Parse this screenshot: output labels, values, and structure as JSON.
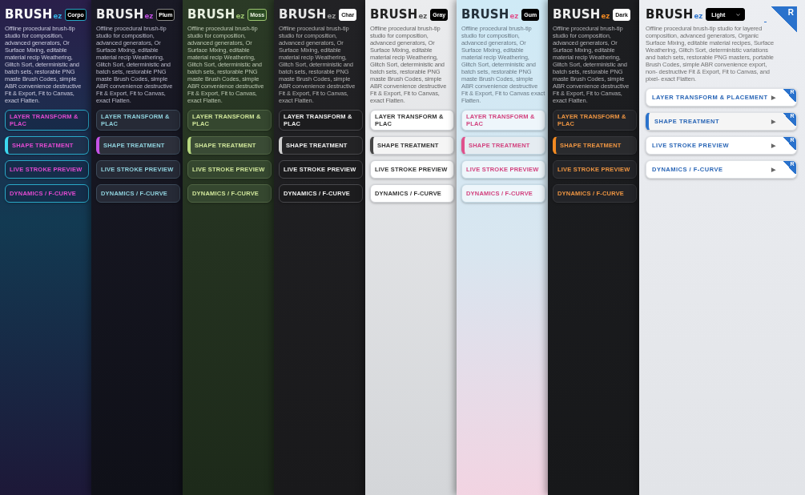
{
  "panels": [
    {
      "kind": "corpo",
      "logo": {
        "main": "BRUSH",
        "accent": "ez"
      },
      "theme_select": {
        "value": "Corpo",
        "dropdown": false
      },
      "description_lines": [
        "Offline procedural brush-tip studio for",
        "composition, advanced generators, Or",
        "Surface Mixing, editable material recip",
        "Weathering, Glitch Sort, deterministic",
        "and batch sets, restorable PNG maste",
        "Brush Codes, simple ABR convenience",
        "destructive Fit & Export, Fit to Canvas,",
        "exact Flatten."
      ],
      "nav": [
        {
          "label": "LAYER TRANSFORM & PLAC",
          "selected": false
        },
        {
          "label": "SHAPE TREATMENT",
          "selected": true
        },
        {
          "label": "LIVE STROKE PREVIEW",
          "selected": false
        },
        {
          "label": "DYNAMICS / F-CURVE",
          "selected": false
        }
      ]
    },
    {
      "kind": "plum",
      "logo": {
        "main": "BRUSH",
        "accent": "ez"
      },
      "theme_select": {
        "value": "Plum",
        "dropdown": false
      },
      "description_lines": [
        "Offline procedural brush-tip studio for",
        "composition, advanced generators, Or",
        "Surface Mixing, editable material recip",
        "Weathering, Glitch Sort, deterministic",
        "and batch sets, restorable PNG maste",
        "Brush Codes, simple ABR convenience",
        "destructive Fit & Export, Fit to Canvas,",
        "exact Flatten."
      ],
      "nav": [
        {
          "label": "LAYER TRANSFORM & PLAC",
          "selected": false
        },
        {
          "label": "SHAPE TREATMENT",
          "selected": true
        },
        {
          "label": "LIVE STROKE PREVIEW",
          "selected": false
        },
        {
          "label": "DYNAMICS / F-CURVE",
          "selected": false
        }
      ]
    },
    {
      "kind": "moss",
      "logo": {
        "main": "BRUSH",
        "accent": "ez"
      },
      "theme_select": {
        "value": "Moss",
        "dropdown": false
      },
      "description_lines": [
        "Offline procedural brush-tip studio for",
        "composition, advanced generators, Or",
        "Surface Mixing, editable material recip",
        "Weathering, Glitch Sort, deterministic",
        "and batch sets, restorable PNG maste",
        "Brush Codes, simple ABR convenience",
        "destructive Fit & Export, Fit to Canvas,",
        "exact Flatten."
      ],
      "nav": [
        {
          "label": "LAYER TRANSFORM & PLAC",
          "selected": false
        },
        {
          "label": "SHAPE TREATMENT",
          "selected": true
        },
        {
          "label": "LIVE STROKE PREVIEW",
          "selected": false
        },
        {
          "label": "DYNAMICS / F-CURVE",
          "selected": false
        }
      ]
    },
    {
      "kind": "char",
      "logo": {
        "main": "BRUSH",
        "accent": "ez"
      },
      "theme_select": {
        "value": "Char",
        "dropdown": false
      },
      "description_lines": [
        "Offline procedural brush-tip studio for",
        "composition, advanced generators, Or",
        "Surface Mixing, editable material recip",
        "Weathering, Glitch Sort, deterministic",
        "and batch sets, restorable PNG maste",
        "Brush Codes, simple ABR convenience",
        "destructive Fit & Export, Fit to Canvas,",
        "exact Flatten."
      ],
      "nav": [
        {
          "label": "LAYER TRANSFORM & PLAC",
          "selected": false
        },
        {
          "label": "SHAPE TREATMENT",
          "selected": true
        },
        {
          "label": "LIVE STROKE PREVIEW",
          "selected": false
        },
        {
          "label": "DYNAMICS / F-CURVE",
          "selected": false
        }
      ]
    },
    {
      "kind": "gray",
      "logo": {
        "main": "BRUSH",
        "accent": "ez"
      },
      "theme_select": {
        "value": "Gray",
        "dropdown": false
      },
      "description_lines": [
        "Offline procedural brush-tip studio for",
        "composition, advanced generators, Or",
        "Surface Mixing, editable material recip",
        "Weathering, Glitch Sort, deterministic",
        "and batch sets, restorable PNG maste",
        "Brush Codes, simple ABR convenience",
        "destructive Fit & Export, Fit to Canvas,",
        "exact Flatten."
      ],
      "nav": [
        {
          "label": "LAYER TRANSFORM & PLAC",
          "selected": false
        },
        {
          "label": "SHAPE TREATMENT",
          "selected": true
        },
        {
          "label": "LIVE STROKE PREVIEW",
          "selected": false
        },
        {
          "label": "DYNAMICS / F-CURVE",
          "selected": false
        }
      ]
    },
    {
      "kind": "gum",
      "logo": {
        "main": "BRUSH",
        "accent": "ez"
      },
      "theme_select": {
        "value": "Gum",
        "dropdown": false
      },
      "description_lines": [
        "Offline procedural brush-tip studio for",
        "composition, advanced generators, Or",
        "Surface Mixing, editable material recip",
        "Weathering, Glitch Sort, deterministic",
        "and batch sets, restorable PNG maste",
        "Brush Codes, simple ABR convenience",
        "destructive Fit & Export, Fit to Canvas",
        "exact Flatten."
      ],
      "nav": [
        {
          "label": "LAYER TRANSFORM & PLAC",
          "selected": false
        },
        {
          "label": "SHAPE TREATMENT",
          "selected": true
        },
        {
          "label": "LIVE STROKE PREVIEW",
          "selected": false
        },
        {
          "label": "DYNAMICS / F-CURVE",
          "selected": false
        }
      ]
    },
    {
      "kind": "dark",
      "logo": {
        "main": "BRUSH",
        "accent": "ez"
      },
      "theme_select": {
        "value": "Dark",
        "dropdown": false
      },
      "description_lines": [
        "Offline procedural brush-tip studio for",
        "composition, advanced generators, Or",
        "Surface Mixing, editable material recip",
        "Weathering, Glitch Sort, deterministic",
        "and batch sets, restorable PNG maste",
        "Brush Codes, simple ABR convenience",
        "destructive Fit & Export, Fit to Canvas,",
        "exact Flatten."
      ],
      "nav": [
        {
          "label": "LAYER TRANSFORM & PLAC",
          "selected": false
        },
        {
          "label": "SHAPE TREATMENT",
          "selected": true
        },
        {
          "label": "LIVE STROKE PREVIEW",
          "selected": false
        },
        {
          "label": "DYNAMICS / F-CURVE",
          "selected": false
        }
      ]
    },
    {
      "kind": "light",
      "logo": {
        "main": "BRUSH",
        "accent": "ez"
      },
      "theme_select": {
        "value": "Light",
        "dropdown": true
      },
      "corner_badge": "R",
      "description_lines": [
        "Offline procedural brush-tip studio for layered",
        "composition, advanced generators, Organic",
        "Surface Mixing, editable material recipes, Surface",
        "Weathering, Glitch Sort, deterministic variations",
        "and batch sets, restorable PNG masters, portable",
        "Brush Codes, simple ABR convenience export, non-",
        "destructive Fit & Export, Fit to Canvas, and pixel-",
        "exact Flatten."
      ],
      "nav": [
        {
          "label": "LAYER TRANSFORM & PLACEMENT",
          "selected": false,
          "arrow": "▶",
          "badge": "R"
        },
        {
          "label": "SHAPE TREATMENT",
          "selected": true,
          "arrow": "▶",
          "badge": "R"
        },
        {
          "label": "LIVE STROKE PREVIEW",
          "selected": false,
          "arrow": "▶",
          "badge": "R"
        },
        {
          "label": "DYNAMICS / F-CURVE",
          "selected": false,
          "arrow": "▶",
          "badge": "R"
        }
      ]
    }
  ]
}
